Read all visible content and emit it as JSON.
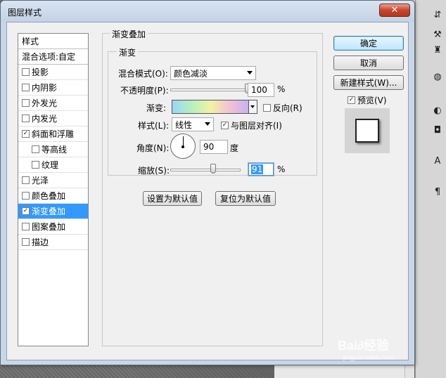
{
  "dialog": {
    "title": "图层样式",
    "close_glyph": "✕"
  },
  "style_list": {
    "header": "样式",
    "blend_options": "混合选项:自定",
    "items": [
      {
        "label": "投影",
        "checked": false
      },
      {
        "label": "内阴影",
        "checked": false
      },
      {
        "label": "外发光",
        "checked": false
      },
      {
        "label": "内发光",
        "checked": false
      },
      {
        "label": "斜面和浮雕",
        "checked": true
      },
      {
        "label": "等高线",
        "checked": false
      },
      {
        "label": "纹理",
        "checked": false
      },
      {
        "label": "光泽",
        "checked": false
      },
      {
        "label": "颜色叠加",
        "checked": false
      },
      {
        "label": "渐变叠加",
        "checked": true,
        "selected": true
      },
      {
        "label": "图案叠加",
        "checked": false
      },
      {
        "label": "描边",
        "checked": false
      }
    ]
  },
  "gradient_overlay": {
    "group_title": "渐变叠加",
    "sub_group_title": "渐变",
    "blend_mode_label": "混合模式(O):",
    "blend_mode_value": "颜色减淡",
    "opacity_label": "不透明度(P):",
    "opacity_value": "100",
    "opacity_unit": "%",
    "opacity_fraction": 1.0,
    "gradient_label": "渐变:",
    "reverse_label": "反向(R)",
    "reverse_checked": false,
    "style_label": "样式(L):",
    "style_value": "线性",
    "align_label": "与图层对齐(I)",
    "align_checked": true,
    "angle_label": "角度(N):",
    "angle_value": "90",
    "angle_unit": "度",
    "scale_label": "缩放(S):",
    "scale_value": "91",
    "scale_unit": "%",
    "scale_fraction": 0.61,
    "make_default_label": "设置为默认值",
    "reset_default_label": "复位为默认值",
    "gradient_colors": [
      "#9ad6f7",
      "#b5f0c0",
      "#f1f3a3",
      "#f3c1d6",
      "#c7b2ef"
    ]
  },
  "actions": {
    "ok_label": "确定",
    "cancel_label": "取消",
    "new_style_label": "新建样式(W)...",
    "preview_label": "预览(V)",
    "preview_checked": true
  },
  "watermark": {
    "line1": "Bai∂经验",
    "line2": "jingyan.baidu.com"
  }
}
